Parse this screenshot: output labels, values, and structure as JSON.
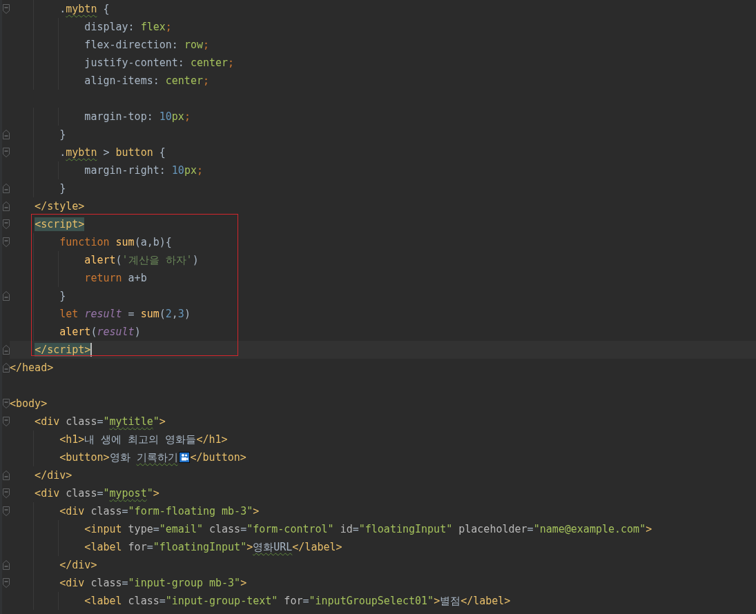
{
  "editor": {
    "blocks": [
      {
        "lines": [
          {
            "kind": "code",
            "fold_start": true,
            "tokens": [
              {
                "text": "        .",
                "kind": "plain"
              },
              {
                "text": "mybtn",
                "kind": "sel",
                "typo": true
              },
              {
                "text": " {",
                "kind": "plain"
              }
            ]
          },
          {
            "kind": "code",
            "tokens": [
              {
                "text": "            display: ",
                "kind": "prop"
              },
              {
                "text": "flex",
                "kind": "val"
              },
              {
                "text": ";",
                "kind": "semi"
              }
            ]
          },
          {
            "kind": "code",
            "tokens": [
              {
                "text": "            flex-direction: ",
                "kind": "prop"
              },
              {
                "text": "row",
                "kind": "val"
              },
              {
                "text": ";",
                "kind": "semi"
              }
            ]
          },
          {
            "kind": "code",
            "tokens": [
              {
                "text": "            justify-content: ",
                "kind": "prop"
              },
              {
                "text": "center",
                "kind": "val"
              },
              {
                "text": ";",
                "kind": "semi"
              }
            ]
          },
          {
            "kind": "code",
            "tokens": [
              {
                "text": "            align-items: ",
                "kind": "prop"
              },
              {
                "text": "center",
                "kind": "val"
              },
              {
                "text": ";",
                "kind": "semi"
              }
            ]
          },
          {
            "kind": "blank"
          },
          {
            "kind": "code",
            "tokens": [
              {
                "text": "            margin-top: ",
                "kind": "prop"
              },
              {
                "text": "10",
                "kind": "num"
              },
              {
                "text": "px",
                "kind": "val"
              },
              {
                "text": ";",
                "kind": "semi"
              }
            ]
          },
          {
            "kind": "code",
            "fold_end": true,
            "tokens": [
              {
                "text": "        }",
                "kind": "plain"
              }
            ]
          },
          {
            "kind": "code",
            "fold_start": true,
            "tokens": [
              {
                "text": "        .",
                "kind": "plain"
              },
              {
                "text": "mybtn",
                "kind": "sel",
                "typo": true
              },
              {
                "text": " > ",
                "kind": "plain"
              },
              {
                "text": "button",
                "kind": "sel"
              },
              {
                "text": " {",
                "kind": "plain"
              }
            ]
          },
          {
            "kind": "code",
            "tokens": [
              {
                "text": "            margin-right: ",
                "kind": "prop"
              },
              {
                "text": "10",
                "kind": "num"
              },
              {
                "text": "px",
                "kind": "val"
              },
              {
                "text": ";",
                "kind": "semi"
              }
            ]
          },
          {
            "kind": "code",
            "fold_end": true,
            "tokens": [
              {
                "text": "        }",
                "kind": "plain"
              }
            ]
          },
          {
            "kind": "code",
            "fold_end": true,
            "tokens": [
              {
                "text": "    </style>",
                "kind": "tag"
              }
            ]
          }
        ]
      },
      {
        "framed": true,
        "lines": [
          {
            "kind": "code",
            "fold_start": true,
            "tokens": [
              {
                "text": "    <script>",
                "kind": "tag",
                "match": true
              }
            ]
          },
          {
            "kind": "code",
            "fold_start": true,
            "tokens": [
              {
                "text": "        function",
                "kind": "kw"
              },
              {
                "text": " sum",
                "kind": "fn"
              },
              {
                "text": "(a,b){",
                "kind": "plain"
              }
            ]
          },
          {
            "kind": "code",
            "tokens": [
              {
                "text": "            alert",
                "kind": "fn"
              },
              {
                "text": "(",
                "kind": "plain"
              },
              {
                "text": "'계산을 하자'",
                "kind": "str"
              },
              {
                "text": ")",
                "kind": "plain"
              }
            ]
          },
          {
            "kind": "code",
            "tokens": [
              {
                "text": "            return",
                "kind": "kw"
              },
              {
                "text": " a+b",
                "kind": "plain"
              }
            ]
          },
          {
            "kind": "code",
            "fold_end": true,
            "tokens": [
              {
                "text": "        }",
                "kind": "plain"
              }
            ]
          },
          {
            "kind": "code",
            "tokens": [
              {
                "text": "        let ",
                "kind": "kw"
              },
              {
                "text": "result",
                "kind": "var"
              },
              {
                "text": " = ",
                "kind": "plain"
              },
              {
                "text": "sum",
                "kind": "fn"
              },
              {
                "text": "(",
                "kind": "plain"
              },
              {
                "text": "2",
                "kind": "num"
              },
              {
                "text": ",",
                "kind": "plain"
              },
              {
                "text": "3",
                "kind": "num"
              },
              {
                "text": ")",
                "kind": "plain"
              }
            ]
          },
          {
            "kind": "code",
            "tokens": [
              {
                "text": "        alert",
                "kind": "fn"
              },
              {
                "text": "(",
                "kind": "plain"
              },
              {
                "text": "result",
                "kind": "var"
              },
              {
                "text": ")",
                "kind": "plain"
              }
            ]
          },
          {
            "kind": "code",
            "fold_end": true,
            "current": true,
            "tokens": [
              {
                "text": "    </script>",
                "kind": "tag",
                "match": true
              }
            ]
          }
        ]
      },
      {
        "lines": [
          {
            "kind": "code",
            "fold_end": true,
            "tokens": [
              {
                "text": "</head>",
                "kind": "tag"
              }
            ]
          },
          {
            "kind": "blank"
          },
          {
            "kind": "code",
            "fold_start": true,
            "tokens": [
              {
                "text": "<body>",
                "kind": "tag"
              }
            ]
          },
          {
            "kind": "code",
            "fold_start": true,
            "tokens": [
              {
                "text": "    <div",
                "kind": "tag"
              },
              {
                "text": " class",
                "kind": "attr"
              },
              {
                "text": "=",
                "kind": "plain"
              },
              {
                "text": "\"",
                "kind": "val"
              },
              {
                "text": "mytitle",
                "kind": "val",
                "typo": true
              },
              {
                "text": "\"",
                "kind": "val"
              },
              {
                "text": ">",
                "kind": "tag"
              }
            ]
          },
          {
            "kind": "code",
            "tokens": [
              {
                "text": "        <h1>",
                "kind": "tag"
              },
              {
                "text": "내 생에 최고의 영화들",
                "kind": "text"
              },
              {
                "text": "</h1>",
                "kind": "tag"
              }
            ]
          },
          {
            "kind": "code",
            "tokens": [
              {
                "text": "        <button>",
                "kind": "tag"
              },
              {
                "text": "영화 ",
                "kind": "text"
              },
              {
                "text": "기록하기",
                "kind": "text",
                "typo": true
              },
              {
                "kind": "icon"
              },
              {
                "text": "</button>",
                "kind": "tag"
              }
            ]
          },
          {
            "kind": "code",
            "fold_end": true,
            "tokens": [
              {
                "text": "    </div>",
                "kind": "tag"
              }
            ]
          },
          {
            "kind": "code",
            "fold_start": true,
            "tokens": [
              {
                "text": "    <div",
                "kind": "tag"
              },
              {
                "text": " class",
                "kind": "attr"
              },
              {
                "text": "=",
                "kind": "plain"
              },
              {
                "text": "\"",
                "kind": "val"
              },
              {
                "text": "mypost",
                "kind": "val",
                "typo": true
              },
              {
                "text": "\"",
                "kind": "val"
              },
              {
                "text": ">",
                "kind": "tag"
              }
            ]
          },
          {
            "kind": "code",
            "fold_start": true,
            "tokens": [
              {
                "text": "        <div",
                "kind": "tag"
              },
              {
                "text": " class",
                "kind": "attr"
              },
              {
                "text": "=",
                "kind": "plain"
              },
              {
                "text": "\"form-floating mb-3\"",
                "kind": "val"
              },
              {
                "text": ">",
                "kind": "tag"
              }
            ]
          },
          {
            "kind": "code",
            "tokens": [
              {
                "text": "            <input",
                "kind": "tag"
              },
              {
                "text": " type",
                "kind": "attr"
              },
              {
                "text": "=",
                "kind": "plain"
              },
              {
                "text": "\"email\"",
                "kind": "val"
              },
              {
                "text": " class",
                "kind": "attr"
              },
              {
                "text": "=",
                "kind": "plain"
              },
              {
                "text": "\"form-control\"",
                "kind": "val"
              },
              {
                "text": " id",
                "kind": "attr"
              },
              {
                "text": "=",
                "kind": "plain"
              },
              {
                "text": "\"floatingInput\"",
                "kind": "val"
              },
              {
                "text": " placeholder",
                "kind": "attr"
              },
              {
                "text": "=",
                "kind": "plain"
              },
              {
                "text": "\"name@example.com\"",
                "kind": "val"
              },
              {
                "text": ">",
                "kind": "tag"
              }
            ]
          },
          {
            "kind": "code",
            "tokens": [
              {
                "text": "            <label",
                "kind": "tag"
              },
              {
                "text": " for",
                "kind": "attr"
              },
              {
                "text": "=",
                "kind": "plain"
              },
              {
                "text": "\"floatingInput\"",
                "kind": "val"
              },
              {
                "text": ">",
                "kind": "tag"
              },
              {
                "text": "영화URL",
                "kind": "text",
                "typo": true
              },
              {
                "text": "</label>",
                "kind": "tag"
              }
            ]
          },
          {
            "kind": "code",
            "fold_end": true,
            "tokens": [
              {
                "text": "        </div>",
                "kind": "tag"
              }
            ]
          },
          {
            "kind": "code",
            "fold_start": true,
            "tokens": [
              {
                "text": "        <div",
                "kind": "tag"
              },
              {
                "text": " class",
                "kind": "attr"
              },
              {
                "text": "=",
                "kind": "plain"
              },
              {
                "text": "\"input-group mb-3\"",
                "kind": "val"
              },
              {
                "text": ">",
                "kind": "tag"
              }
            ]
          },
          {
            "kind": "code",
            "tokens": [
              {
                "text": "            <label",
                "kind": "tag"
              },
              {
                "text": " class",
                "kind": "attr"
              },
              {
                "text": "=",
                "kind": "plain"
              },
              {
                "text": "\"input-group-text\"",
                "kind": "val"
              },
              {
                "text": " for",
                "kind": "attr"
              },
              {
                "text": "=",
                "kind": "plain"
              },
              {
                "text": "\"inputGroupSelect01\"",
                "kind": "val"
              },
              {
                "text": ">",
                "kind": "tag"
              },
              {
                "text": "별점",
                "kind": "text"
              },
              {
                "text": "</label>",
                "kind": "tag"
              }
            ]
          }
        ]
      }
    ]
  }
}
